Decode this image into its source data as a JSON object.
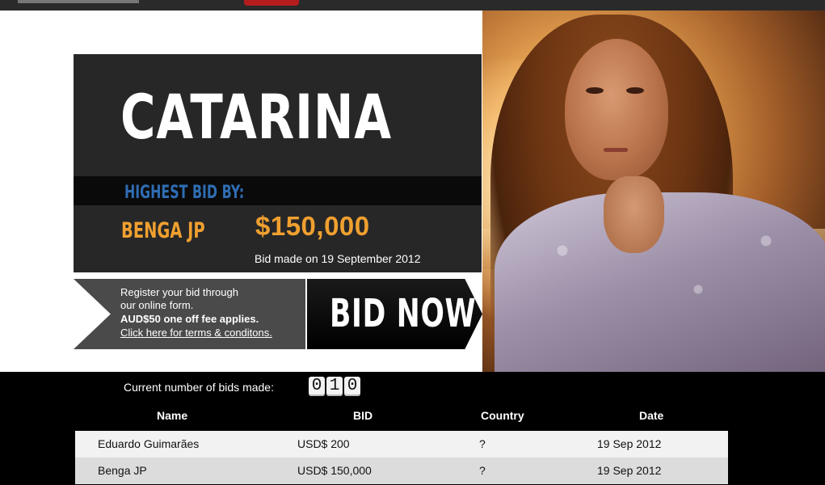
{
  "colors": {
    "accent_orange": "#f0a030",
    "accent_blue": "#2f6db3",
    "panel_dark": "#272727",
    "topbar": "#2a2a2a",
    "nav_tab_red": "#b51d1d"
  },
  "listing": {
    "name": "CATARINA",
    "highest_bid_label": "HIGHEST BID BY:",
    "highest_bidder": "BENGA JP",
    "highest_amount": "$150,000",
    "bid_date_text": "Bid made on 19 September 2012"
  },
  "register": {
    "line1": "Register your bid through",
    "line2": "our online form.",
    "line3": "AUD$50 one off fee applies.",
    "terms_link": "Click here for terms & conditons."
  },
  "bid_button": {
    "label": "BID NOW"
  },
  "bids": {
    "count_label": "Current number of bids made:",
    "count_digits": [
      "0",
      "1",
      "0"
    ],
    "columns": [
      "Name",
      "BID",
      "Country",
      "Date"
    ],
    "rows": [
      {
        "name": "Eduardo Guimarães",
        "bid": "USD$ 200",
        "country": "?",
        "date": "19 Sep 2012"
      },
      {
        "name": "Benga JP",
        "bid": "USD$ 150,000",
        "country": "?",
        "date": "19 Sep 2012"
      }
    ]
  }
}
